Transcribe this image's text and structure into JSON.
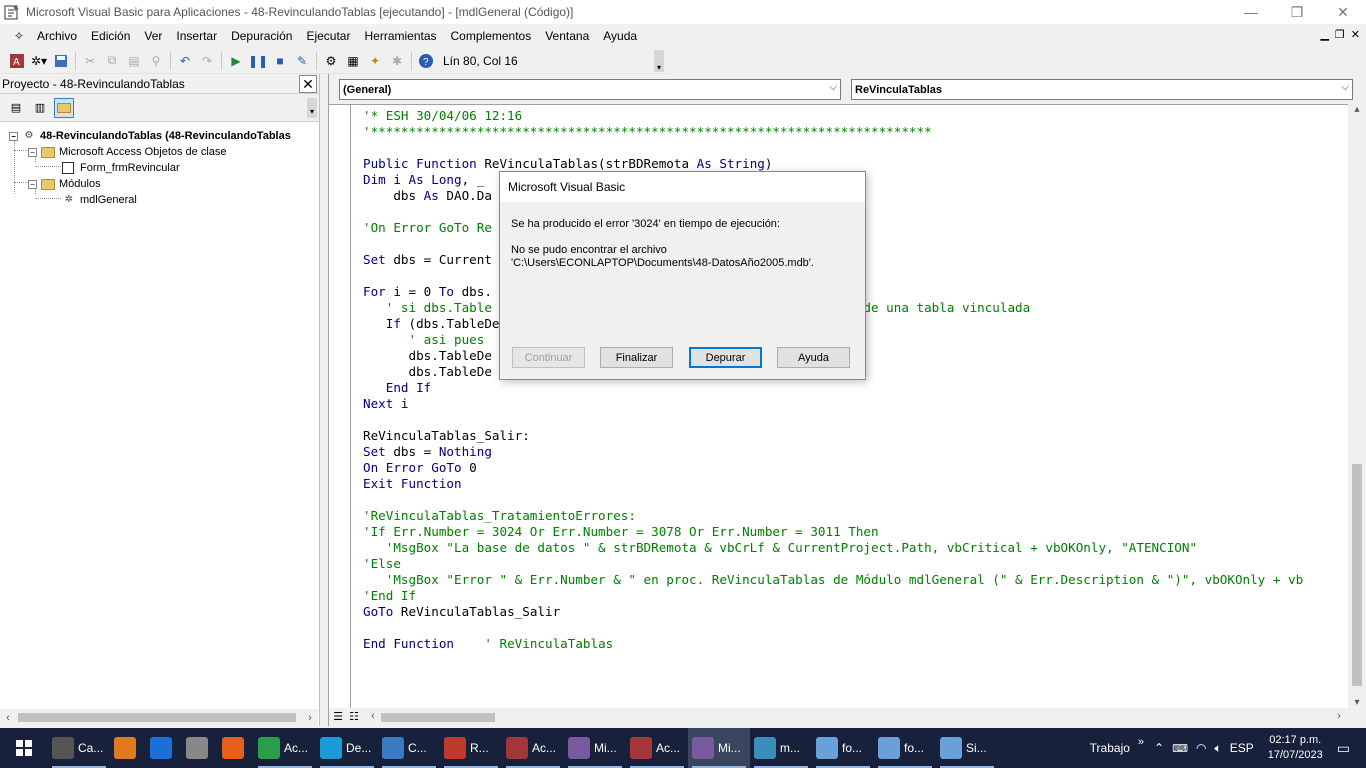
{
  "window": {
    "title": "Microsoft Visual Basic para Aplicaciones - 48-RevinculandoTablas [ejecutando] - [mdlGeneral (Código)]",
    "minimize": "—",
    "restore": "❐",
    "close": "✕"
  },
  "menu": {
    "items": [
      "Archivo",
      "Edición",
      "Ver",
      "Insertar",
      "Depuración",
      "Ejecutar",
      "Herramientas",
      "Complementos",
      "Ventana",
      "Ayuda"
    ],
    "mdi": [
      "▁",
      "❐",
      "✕"
    ]
  },
  "toolbar": {
    "position": "Lín 80, Col 16",
    "icons": [
      "access-icon",
      "insert-icon",
      "save-icon",
      "cut-icon",
      "copy-icon",
      "paste-icon",
      "find-icon",
      "undo-icon",
      "redo-icon",
      "run-icon",
      "break-icon",
      "reset-icon",
      "design-mode-icon",
      "project-explorer-icon",
      "properties-icon",
      "object-browser-icon",
      "toolbox-icon",
      "help-icon"
    ]
  },
  "project": {
    "title": "Proyecto - 48-RevinculandoTablas",
    "close": "✕",
    "tree": {
      "root": "48-RevinculandoTablas (48-RevinculandoTablas",
      "folder1": "Microsoft Access Objetos de clase",
      "form": "Form_frmRevincular",
      "folder2": "Módulos",
      "module": "mdlGeneral"
    }
  },
  "code": {
    "object_combo": "(General)",
    "proc_combo": "ReVinculaTablas",
    "lines": [
      [
        [
          "cm",
          "'* ESH 30/04/06 12:16"
        ]
      ],
      [
        [
          "cm",
          "'**************************************************************************"
        ]
      ],
      [
        [
          "tx",
          ""
        ]
      ],
      [
        [
          "kw",
          "Public Function "
        ],
        [
          "tx",
          "ReVinculaTablas(strBDRemota "
        ],
        [
          "kw",
          "As String"
        ],
        [
          "tx",
          ")"
        ]
      ],
      [
        [
          "kw",
          "Dim "
        ],
        [
          "tx",
          "i "
        ],
        [
          "kw",
          "As Long"
        ],
        [
          "tx",
          ", _"
        ]
      ],
      [
        [
          "tx",
          "    dbs "
        ],
        [
          "kw",
          "As "
        ],
        [
          "tx",
          "DAO.Da"
        ]
      ],
      [
        [
          "tx",
          ""
        ]
      ],
      [
        [
          "cm",
          "'On Error GoTo Re"
        ]
      ],
      [
        [
          "tx",
          ""
        ]
      ],
      [
        [
          "kw",
          "Set "
        ],
        [
          "tx",
          "dbs = Current"
        ]
      ],
      [
        [
          "tx",
          ""
        ]
      ],
      [
        [
          "kw",
          "For "
        ],
        [
          "tx",
          "i = 0 "
        ],
        [
          "kw",
          "To "
        ],
        [
          "tx",
          "dbs."
        ]
      ],
      [
        [
          "cm",
          "   ' si dbs.Table                                            rata de una tabla vinculada"
        ]
      ],
      [
        [
          "tx",
          "   "
        ],
        [
          "kw",
          "If "
        ],
        [
          "tx",
          "(dbs.TableDe"
        ]
      ],
      [
        [
          "cm",
          "      ' asi pues "
        ]
      ],
      [
        [
          "tx",
          "      dbs.TableDe                                      ;\""
        ]
      ],
      [
        [
          "tx",
          "      dbs.TableDe"
        ]
      ],
      [
        [
          "tx",
          "   "
        ],
        [
          "kw",
          "End If"
        ]
      ],
      [
        [
          "kw",
          "Next "
        ],
        [
          "tx",
          "i"
        ]
      ],
      [
        [
          "tx",
          ""
        ]
      ],
      [
        [
          "tx",
          "ReVinculaTablas_Salir:"
        ]
      ],
      [
        [
          "kw",
          "Set "
        ],
        [
          "tx",
          "dbs = "
        ],
        [
          "kw",
          "Nothing"
        ]
      ],
      [
        [
          "kw",
          "On Error GoTo "
        ],
        [
          "tx",
          "0"
        ]
      ],
      [
        [
          "kw",
          "Exit Function"
        ]
      ],
      [
        [
          "tx",
          ""
        ]
      ],
      [
        [
          "cm",
          "'ReVinculaTablas_TratamientoErrores:"
        ]
      ],
      [
        [
          "cm",
          "'If Err.Number = 3024 Or Err.Number = 3078 Or Err.Number = 3011 Then"
        ]
      ],
      [
        [
          "cm",
          "   'MsgBox \"La base de datos \" & strBDRemota & vbCrLf & CurrentProject.Path, vbCritical + vbOKOnly, \"ATENCION\""
        ]
      ],
      [
        [
          "cm",
          "'Else"
        ]
      ],
      [
        [
          "cm",
          "   'MsgBox \"Error \" & Err.Number & \" en proc. ReVinculaTablas de Módulo mdlGeneral (\" & Err.Description & \")\", vbOKOnly + vb"
        ]
      ],
      [
        [
          "cm",
          "'End If"
        ]
      ],
      [
        [
          "kw",
          "GoTo "
        ],
        [
          "tx",
          "ReVinculaTablas_Salir"
        ]
      ],
      [
        [
          "tx",
          ""
        ]
      ],
      [
        [
          "kw",
          "End Function"
        ],
        [
          "tx",
          "    "
        ],
        [
          "cm",
          "' ReVinculaTablas"
        ]
      ]
    ]
  },
  "dialog": {
    "title": "Microsoft Visual Basic",
    "message1": "Se ha producido el error '3024' en tiempo de ejecución:",
    "message2": "No se pudo encontrar el archivo",
    "message3": "'C:\\Users\\ECONLAPTOP\\Documents\\48-DatosAño2005.mdb'.",
    "buttons": [
      "Continuar",
      "Finalizar",
      "Depurar",
      "Ayuda"
    ]
  },
  "taskbar": {
    "items": [
      {
        "label": "Ca...",
        "icon": "calculator-icon",
        "color": "#555555"
      },
      {
        "label": "",
        "icon": "search-app-icon",
        "color": "#e07a1f"
      },
      {
        "label": "",
        "icon": "media-player-icon",
        "color": "#1a6fd8"
      },
      {
        "label": "",
        "icon": "tools-icon",
        "color": "#888888"
      },
      {
        "label": "",
        "icon": "firefox-icon",
        "color": "#e8611c"
      },
      {
        "label": "Ac...",
        "icon": "chrome-icon",
        "color": "#2a9d4a"
      },
      {
        "label": "De...",
        "icon": "desktop-icon",
        "color": "#1a9bd7"
      },
      {
        "label": "C...",
        "icon": "notes-icon",
        "color": "#3b7bc4"
      },
      {
        "label": "R...",
        "icon": "reader-icon",
        "color": "#c0392b"
      },
      {
        "label": "Ac...",
        "icon": "access-icon",
        "color": "#a4373a"
      },
      {
        "label": "Mi...",
        "icon": "vba-icon",
        "color": "#7a5a9e"
      },
      {
        "label": "Ac...",
        "icon": "access-icon",
        "color": "#a4373a"
      },
      {
        "label": "Mi...",
        "icon": "vba-icon",
        "color": "#7a5a9e"
      },
      {
        "label": "m...",
        "icon": "image-icon",
        "color": "#3c8dbc"
      },
      {
        "label": "fo...",
        "icon": "paint-icon",
        "color": "#6aa0d8"
      },
      {
        "label": "fo...",
        "icon": "paint-icon",
        "color": "#6aa0d8"
      },
      {
        "label": "Si...",
        "icon": "paint-icon",
        "color": "#6aa0d8"
      }
    ],
    "active_index": 12,
    "workspace": "Trabajo",
    "chevron": "»",
    "lang": "ESP",
    "time": "02:17 p.m.",
    "date": "17/07/2023"
  }
}
